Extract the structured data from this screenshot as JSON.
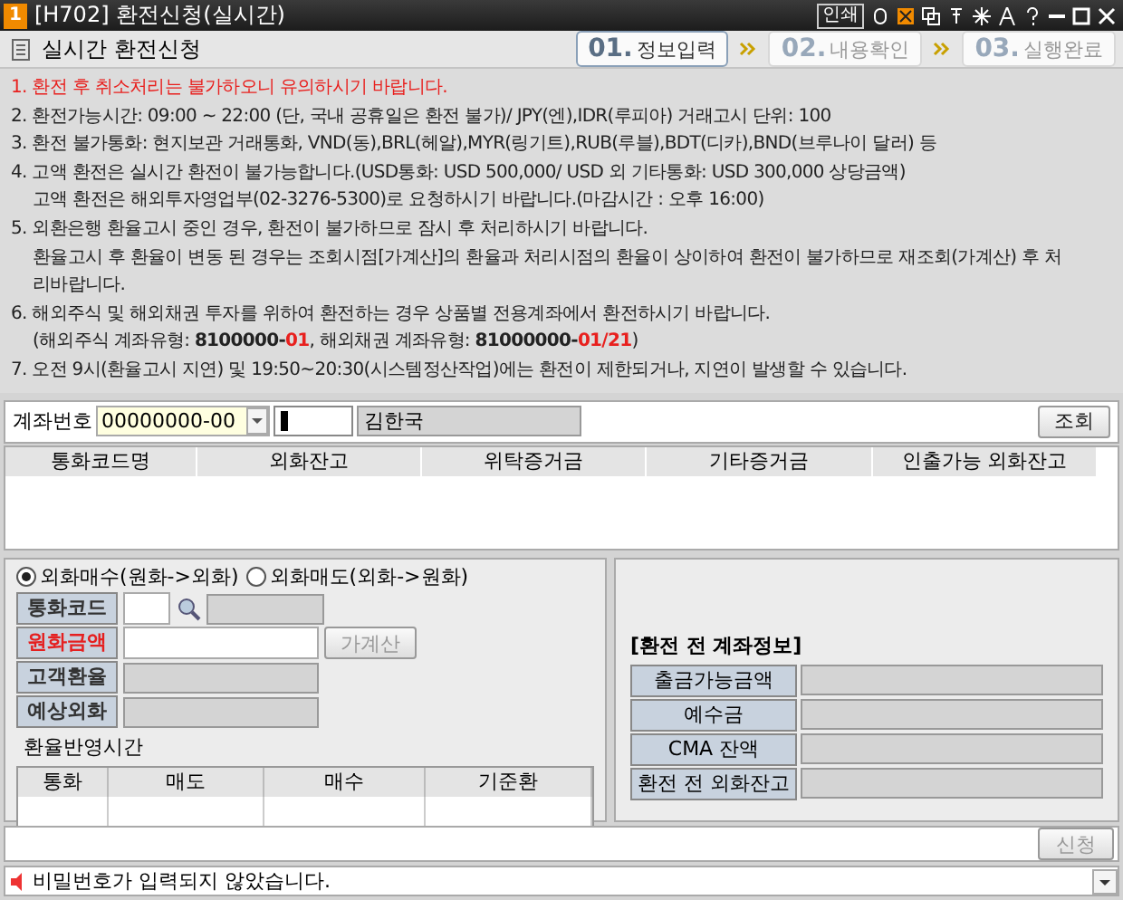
{
  "window": {
    "badge": "1",
    "title": "[H702] 환전신청(실시간)",
    "print_button": "인쇄"
  },
  "header": {
    "title": "실시간 환전신청",
    "steps": [
      {
        "number": "01.",
        "label": "정보입력",
        "selected": true
      },
      {
        "number": "02.",
        "label": "내용확인",
        "selected": false
      },
      {
        "number": "03.",
        "label": "실행완료",
        "selected": false
      }
    ]
  },
  "notices": [
    {
      "continuation": false,
      "parts": [
        {
          "kind": "alert",
          "text": "1. 환전 후 취소처리는 불가하오니 유의하시기 바랍니다."
        }
      ]
    },
    {
      "continuation": false,
      "parts": [
        {
          "kind": "plain",
          "text": "2. 환전가능시간: 09:00 ~ 22:00 (단, 국내 공휴일은 환전 불가)/ JPY(엔),IDR(루피아) 거래고시 단위: 100"
        }
      ]
    },
    {
      "continuation": false,
      "parts": [
        {
          "kind": "plain",
          "text": "3. 환전 불가통화: 현지보관 거래통화, VND(동),BRL(헤알),MYR(링기트),RUB(루블),BDT(디카),BND(브루나이 달러) 등"
        }
      ]
    },
    {
      "continuation": false,
      "parts": [
        {
          "kind": "plain",
          "text": "4. 고액 환전은 실시간 환전이 불가능합니다.(USD통화: USD 500,000/ USD 외 기타통화: USD 300,000 상당금액)"
        }
      ]
    },
    {
      "continuation": true,
      "parts": [
        {
          "kind": "plain",
          "text": "고액 환전은 해외투자영업부(02-3276-5300)로 요청하시기 바랍니다.(마감시간 : 오후 16:00)"
        }
      ]
    },
    {
      "continuation": false,
      "parts": [
        {
          "kind": "plain",
          "text": "5. 외환은행 환율고시 중인 경우, 환전이 불가하므로 잠시 후 처리하시기 바랍니다."
        }
      ]
    },
    {
      "continuation": true,
      "parts": [
        {
          "kind": "plain",
          "text": "환율고시 후 환율이 변동 된 경우는 조회시점[가계산]의 환율과 처리시점의 환율이 상이하여 환전이 불가하므로 재조회(가계산) 후 처리바랍니다."
        }
      ]
    },
    {
      "continuation": false,
      "parts": [
        {
          "kind": "plain",
          "text": "6. 해외주식 및 해외채권 투자를 위하여 환전하는 경우 상품별 전용계좌에서 환전하시기 바랍니다."
        }
      ]
    },
    {
      "continuation": true,
      "parts": [
        {
          "kind": "plain",
          "text": "(해외주식 계좌유형: "
        },
        {
          "kind": "bold",
          "text": "8100000-"
        },
        {
          "kind": "alert-bold",
          "text": "01"
        },
        {
          "kind": "plain",
          "text": ", 해외채권 계좌유형: "
        },
        {
          "kind": "bold",
          "text": "81000000-"
        },
        {
          "kind": "alert-bold",
          "text": "01/21"
        },
        {
          "kind": "plain",
          "text": ")"
        }
      ]
    },
    {
      "continuation": false,
      "parts": [
        {
          "kind": "plain",
          "text": "7. 오전 9시(환율고시 지연) 및 19:50~20:30(시스템정산작업)에는 환전이 제한되거나, 지연이 발생할 수 있습니다."
        }
      ]
    }
  ],
  "account": {
    "label": "계좌번호",
    "number": "00000000-00",
    "holder": "김한국",
    "search_button": "조회"
  },
  "balance_table": {
    "columns": [
      "통화코드명",
      "외화잔고",
      "위탁증거금",
      "기타증거금",
      "인출가능 외화잔고"
    ]
  },
  "exchange_form": {
    "modes": [
      {
        "label": "외화매수(원화->외화)",
        "selected": true
      },
      {
        "label": "외화매도(외화->원화)",
        "selected": false
      }
    ],
    "fields": [
      {
        "label": "통화코드",
        "kind": "code",
        "required": false
      },
      {
        "label": "원화금액",
        "kind": "amount",
        "required": true
      },
      {
        "label": "고객환율",
        "kind": "readonly",
        "required": false
      },
      {
        "label": "예상외화",
        "kind": "readonly",
        "required": false
      }
    ],
    "calc_button": "가계산",
    "rate_time_label": "환율반영시간",
    "rate_table": {
      "columns": [
        "통화",
        "매도",
        "매수",
        "기준환"
      ]
    }
  },
  "account_info": {
    "title": "[환전 전 계좌정보]",
    "rows": [
      "출금가능금액",
      "예수금",
      "CMA 잔액",
      "환전 전 외화잔고"
    ]
  },
  "submit_button": "신청",
  "status_bar": {
    "message": "비밀번호가 입력되지 않았습니다."
  }
}
